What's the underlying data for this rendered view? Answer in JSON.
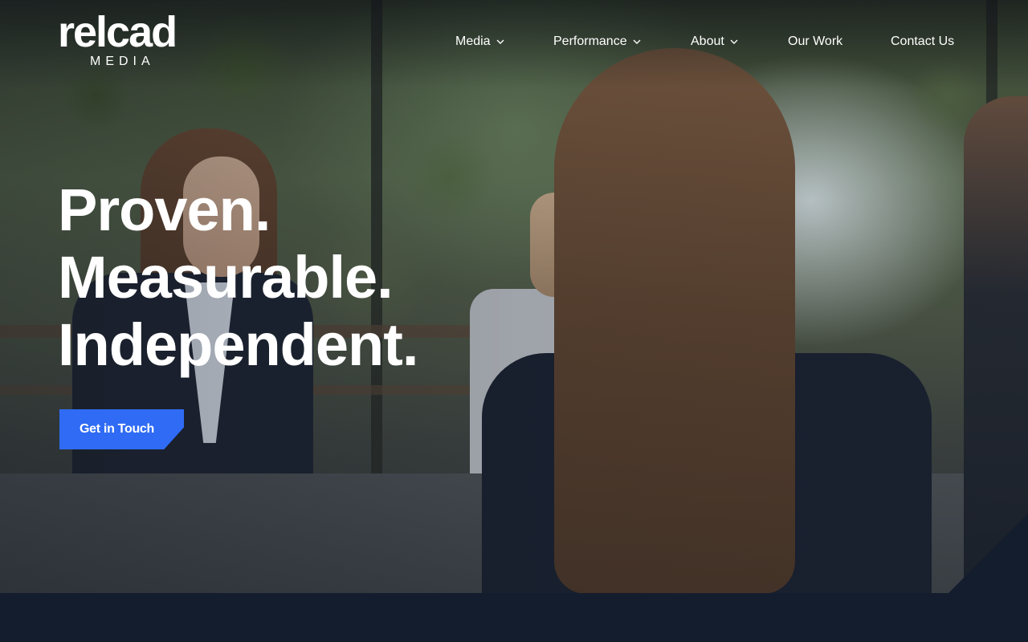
{
  "brand": {
    "logo_word": "relcad",
    "logo_sub": "MEDIA"
  },
  "nav": {
    "items": [
      {
        "label": "Media",
        "has_dropdown": true
      },
      {
        "label": "Performance",
        "has_dropdown": true
      },
      {
        "label": "About",
        "has_dropdown": true
      },
      {
        "label": "Our Work",
        "has_dropdown": false
      },
      {
        "label": "Contact Us",
        "has_dropdown": false
      }
    ]
  },
  "hero": {
    "headline": [
      "Proven.",
      "Measurable.",
      "Independent."
    ],
    "cta_label": "Get in Touch"
  },
  "colors": {
    "accent": "#2f6bf5",
    "footer_band": "#141d2e",
    "text": "#ffffff"
  },
  "icons": {
    "dropdown": "chevron-down-icon"
  }
}
